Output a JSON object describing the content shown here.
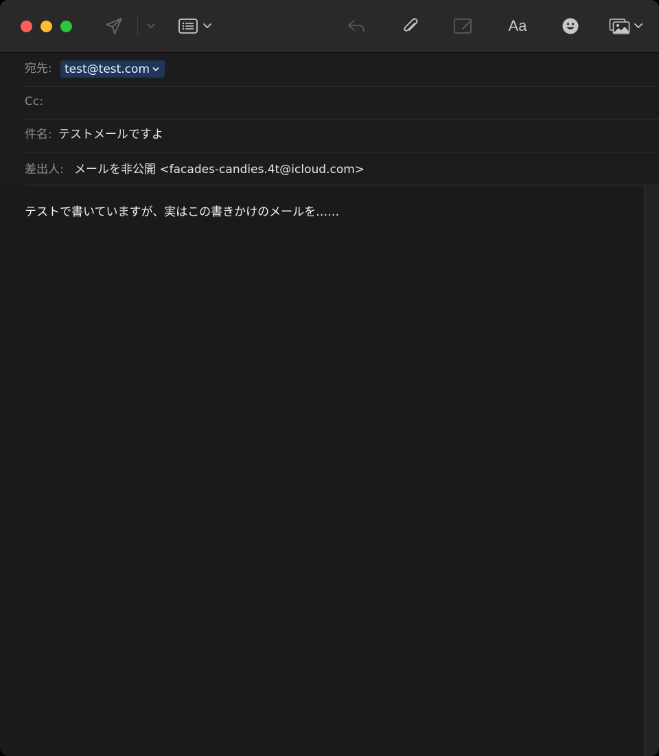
{
  "toolbar": {
    "icons": [
      "send-icon",
      "chevron-down-icon",
      "header-fields-icon",
      "reply-icon",
      "attachment-icon",
      "markup-icon",
      "format-icon",
      "emoji-icon",
      "photo-browser-icon"
    ],
    "format_label": "Aa"
  },
  "headers": {
    "to_label": "宛先:",
    "to_recipient": "test@test.com",
    "cc_label": "Cc:",
    "subject_label": "件名:",
    "subject_value": "テストメールですよ",
    "from_label": "差出人:",
    "from_value": "メールを非公開 <facades-candies.4t@icloud.com>"
  },
  "body": {
    "text": "テストで書いていますが、実はこの書きかけのメールを……"
  },
  "colors": {
    "close": "#ff5f57",
    "minimize": "#febc2e",
    "maximize": "#28c840",
    "token_bg": "#1e3659",
    "window_bg": "#1c1c1c"
  }
}
